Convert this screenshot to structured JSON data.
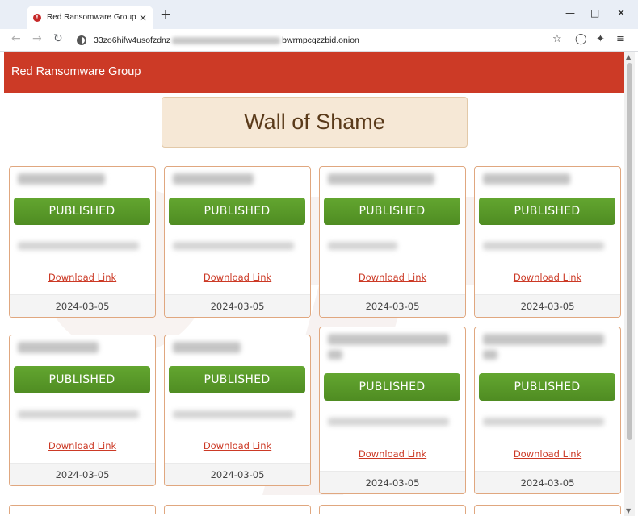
{
  "browser": {
    "tab_title": "Red Ransomware Group - Wall",
    "tab_close": "×",
    "new_tab": "+",
    "url_start": "33zo6hifw4usofzdnz",
    "url_end": "bwrmpcqzzbid.onion",
    "icons": [
      "back-arrow-icon",
      "forward-arrow-icon",
      "reload-icon",
      "site-info-icon",
      "star-icon",
      "shield-icon",
      "extensions-icon",
      "menu-icon"
    ]
  },
  "site": {
    "brand": "Red Ransomware Group",
    "accent": "#cc3a26",
    "wall_title": "Wall of Shame"
  },
  "cards": [
    {
      "status": "PUBLISHED",
      "link": "Download Link",
      "date": "2024-03-05"
    },
    {
      "status": "PUBLISHED",
      "link": "Download Link",
      "date": "2024-03-05"
    },
    {
      "status": "PUBLISHED",
      "link": "Download Link",
      "date": "2024-03-05"
    },
    {
      "status": "PUBLISHED",
      "link": "Download Link",
      "date": "2024-03-05"
    },
    {
      "status": "PUBLISHED",
      "link": "Download Link",
      "date": "2024-03-05"
    },
    {
      "status": "PUBLISHED",
      "link": "Download Link",
      "date": "2024-03-05"
    },
    {
      "status": "PUBLISHED",
      "link": "Download Link",
      "date": "2024-03-05"
    },
    {
      "status": "PUBLISHED",
      "link": "Download Link",
      "date": "2024-03-05"
    }
  ]
}
